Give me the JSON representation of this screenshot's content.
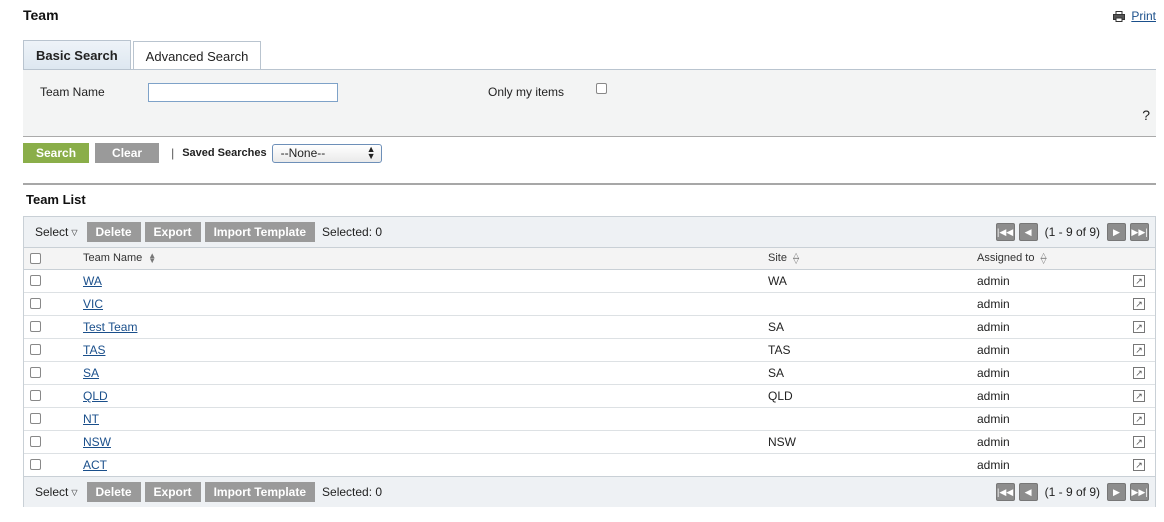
{
  "header": {
    "title": "Team",
    "print_label": "Print"
  },
  "tabs": [
    {
      "label": "Basic Search",
      "active": true
    },
    {
      "label": "Advanced Search",
      "active": false
    }
  ],
  "search": {
    "team_name_label": "Team Name",
    "team_name_value": "",
    "only_my_items_label": "Only my items",
    "help_label": "?",
    "search_button": "Search",
    "clear_button": "Clear",
    "separator": "|",
    "saved_searches_label": "Saved Searches",
    "saved_searches_value": "--None--"
  },
  "list": {
    "title": "Team List",
    "toolbar": {
      "select_label": "Select",
      "delete_label": "Delete",
      "export_label": "Export",
      "import_label": "Import Template",
      "selected_text": "Selected: 0",
      "pager_text": "(1 - 9 of 9)"
    },
    "columns": {
      "name": "Team Name",
      "site": "Site",
      "assigned": "Assigned to"
    },
    "rows": [
      {
        "name": "WA",
        "site": "WA",
        "assigned": "admin"
      },
      {
        "name": "VIC",
        "site": "",
        "assigned": "admin"
      },
      {
        "name": "Test Team",
        "site": "SA",
        "assigned": "admin"
      },
      {
        "name": "TAS",
        "site": "TAS",
        "assigned": "admin"
      },
      {
        "name": "SA",
        "site": "SA",
        "assigned": "admin"
      },
      {
        "name": "QLD",
        "site": "QLD",
        "assigned": "admin"
      },
      {
        "name": "NT",
        "site": "",
        "assigned": "admin"
      },
      {
        "name": "NSW",
        "site": "NSW",
        "assigned": "admin"
      },
      {
        "name": "ACT",
        "site": "",
        "assigned": "admin"
      }
    ]
  },
  "colors": {
    "search_green": "#8aae49",
    "button_gray": "#9a9a9a",
    "link_blue": "#1a4f8b"
  }
}
